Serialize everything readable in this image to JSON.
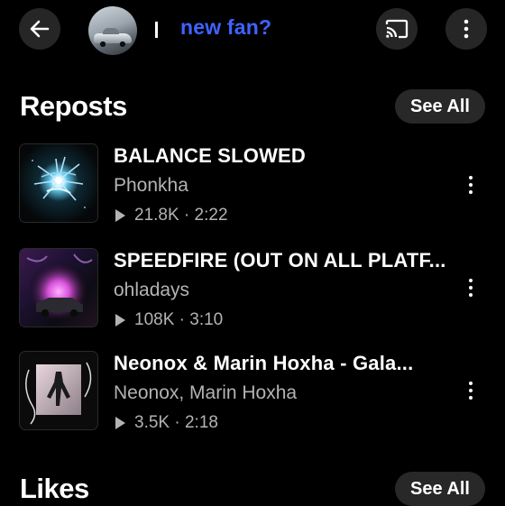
{
  "header": {
    "username": "new fan?"
  },
  "reposts": {
    "title": "Reposts",
    "see_all": "See All",
    "tracks": [
      {
        "title": "BALANCE SLOWED",
        "artist": "Phonkha",
        "stats": "21.8K · 2:22"
      },
      {
        "title": "SPEEDFIRE (OUT ON ALL PLATF...",
        "artist": "ohladays",
        "stats": "108K · 3:10"
      },
      {
        "title": "Neonox & Marin Hoxha - Gala...",
        "artist": "Neonox, Marin Hoxha",
        "stats": "3.5K · 2:18"
      }
    ]
  },
  "likes": {
    "title": "Likes",
    "see_all": "See All"
  },
  "icons": {
    "back": "arrow-left-icon",
    "cast": "cast-icon",
    "more": "more-vertical-icon",
    "play": "play-icon"
  }
}
